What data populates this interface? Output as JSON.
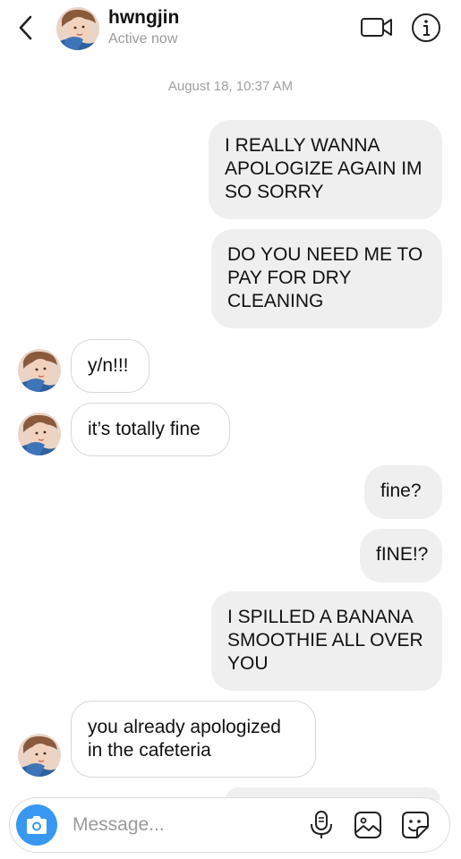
{
  "header": {
    "contact_name": "hwngjin",
    "status": "Active now",
    "back_icon": "chevron-left-icon",
    "video_icon": "video-camera-icon",
    "info_icon": "info-icon"
  },
  "conversation": {
    "timestamp": "August 18, 10:37 AM",
    "messages": [
      {
        "direction": "sent",
        "text": "I REALLY WANNA\nAPOLOGIZE AGAIN IM\nSO SORRY"
      },
      {
        "direction": "sent",
        "text": "DO YOU NEED ME TO\nPAY FOR DRY\nCLEANING"
      },
      {
        "direction": "received",
        "text": "y/n!!!"
      },
      {
        "direction": "received",
        "text": "it’s totally fine"
      },
      {
        "direction": "sent",
        "text": "fine?"
      },
      {
        "direction": "sent",
        "text": "fINE!?"
      },
      {
        "direction": "sent",
        "text": "I SPILLED A BANANA\nSMOOTHIE ALL OVER\nYOU"
      },
      {
        "direction": "received",
        "text": "you already apologized\nin the cafeteria"
      }
    ]
  },
  "composer": {
    "placeholder": "Message...",
    "value": "",
    "camera_icon": "camera-icon",
    "mic_icon": "microphone-icon",
    "gallery_icon": "gallery-icon",
    "sticker_icon": "sticker-icon"
  },
  "colors": {
    "accent": "#3897f0",
    "sent_bubble": "#efefef",
    "received_border": "#d8d8d8",
    "muted_text": "#9a9a9a"
  }
}
